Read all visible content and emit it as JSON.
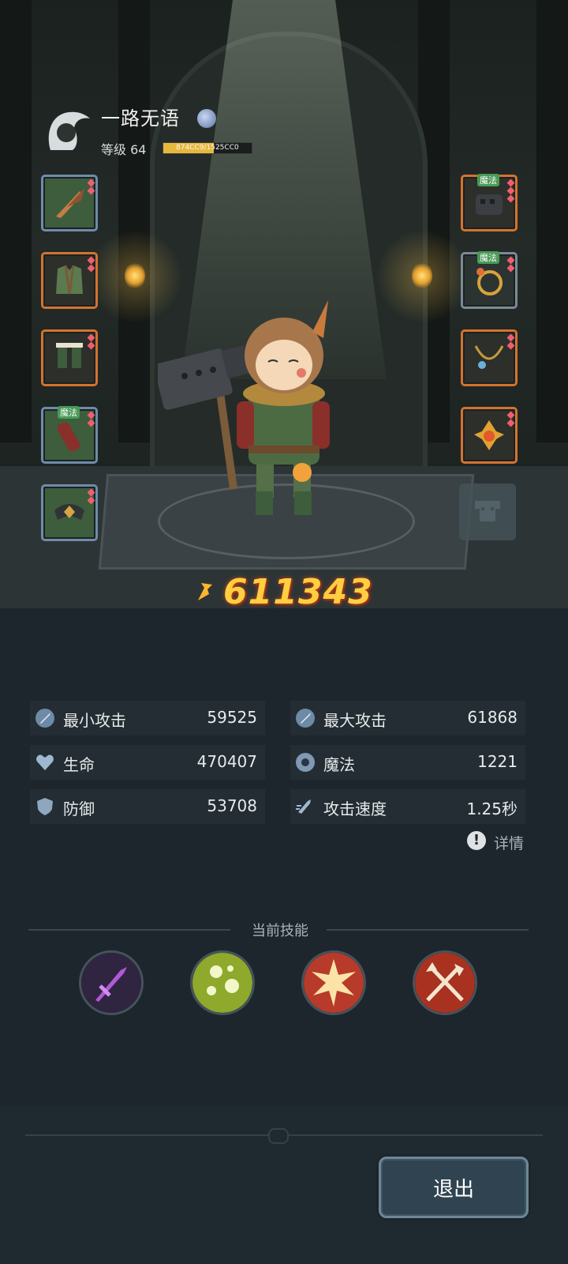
{
  "player": {
    "name": "一路无语",
    "level_label": "等级 64",
    "exp_text": "874CC9/1525CC0",
    "exp_fraction": 0.57
  },
  "equipment": {
    "left": [
      {
        "name": "feather-weapon",
        "tag": ""
      },
      {
        "name": "armor-vest",
        "tag": ""
      },
      {
        "name": "boots",
        "tag": ""
      },
      {
        "name": "bracer",
        "tag": "魔法"
      },
      {
        "name": "helmet",
        "tag": ""
      }
    ],
    "right": [
      {
        "name": "gauntlet",
        "tag": "魔法"
      },
      {
        "name": "ring",
        "tag": "魔法"
      },
      {
        "name": "necklace",
        "tag": ""
      },
      {
        "name": "amulet",
        "tag": ""
      }
    ]
  },
  "combat_power": "611343",
  "stats": [
    {
      "label": "最小攻击",
      "value": "59525",
      "icon": "sword-icon"
    },
    {
      "label": "最大攻击",
      "value": "61868",
      "icon": "sword-icon"
    },
    {
      "label": "生命",
      "value": "470407",
      "icon": "heart-icon"
    },
    {
      "label": "魔法",
      "value": "1221",
      "icon": "magic-icon"
    },
    {
      "label": "防御",
      "value": "53708",
      "icon": "shield-icon"
    },
    {
      "label": "攻击速度",
      "value": "1.25秒",
      "icon": "speed-icon"
    }
  ],
  "details_label": "详情",
  "skills_title": "当前技能",
  "skills": [
    "purple-dagger-skill",
    "green-orb-skill",
    "fire-burst-skill",
    "crossed-axes-skill"
  ],
  "exit_label": "退出",
  "colors": {
    "power": "#ffcf40",
    "panel": "#232d33",
    "background": "#1c262c"
  }
}
